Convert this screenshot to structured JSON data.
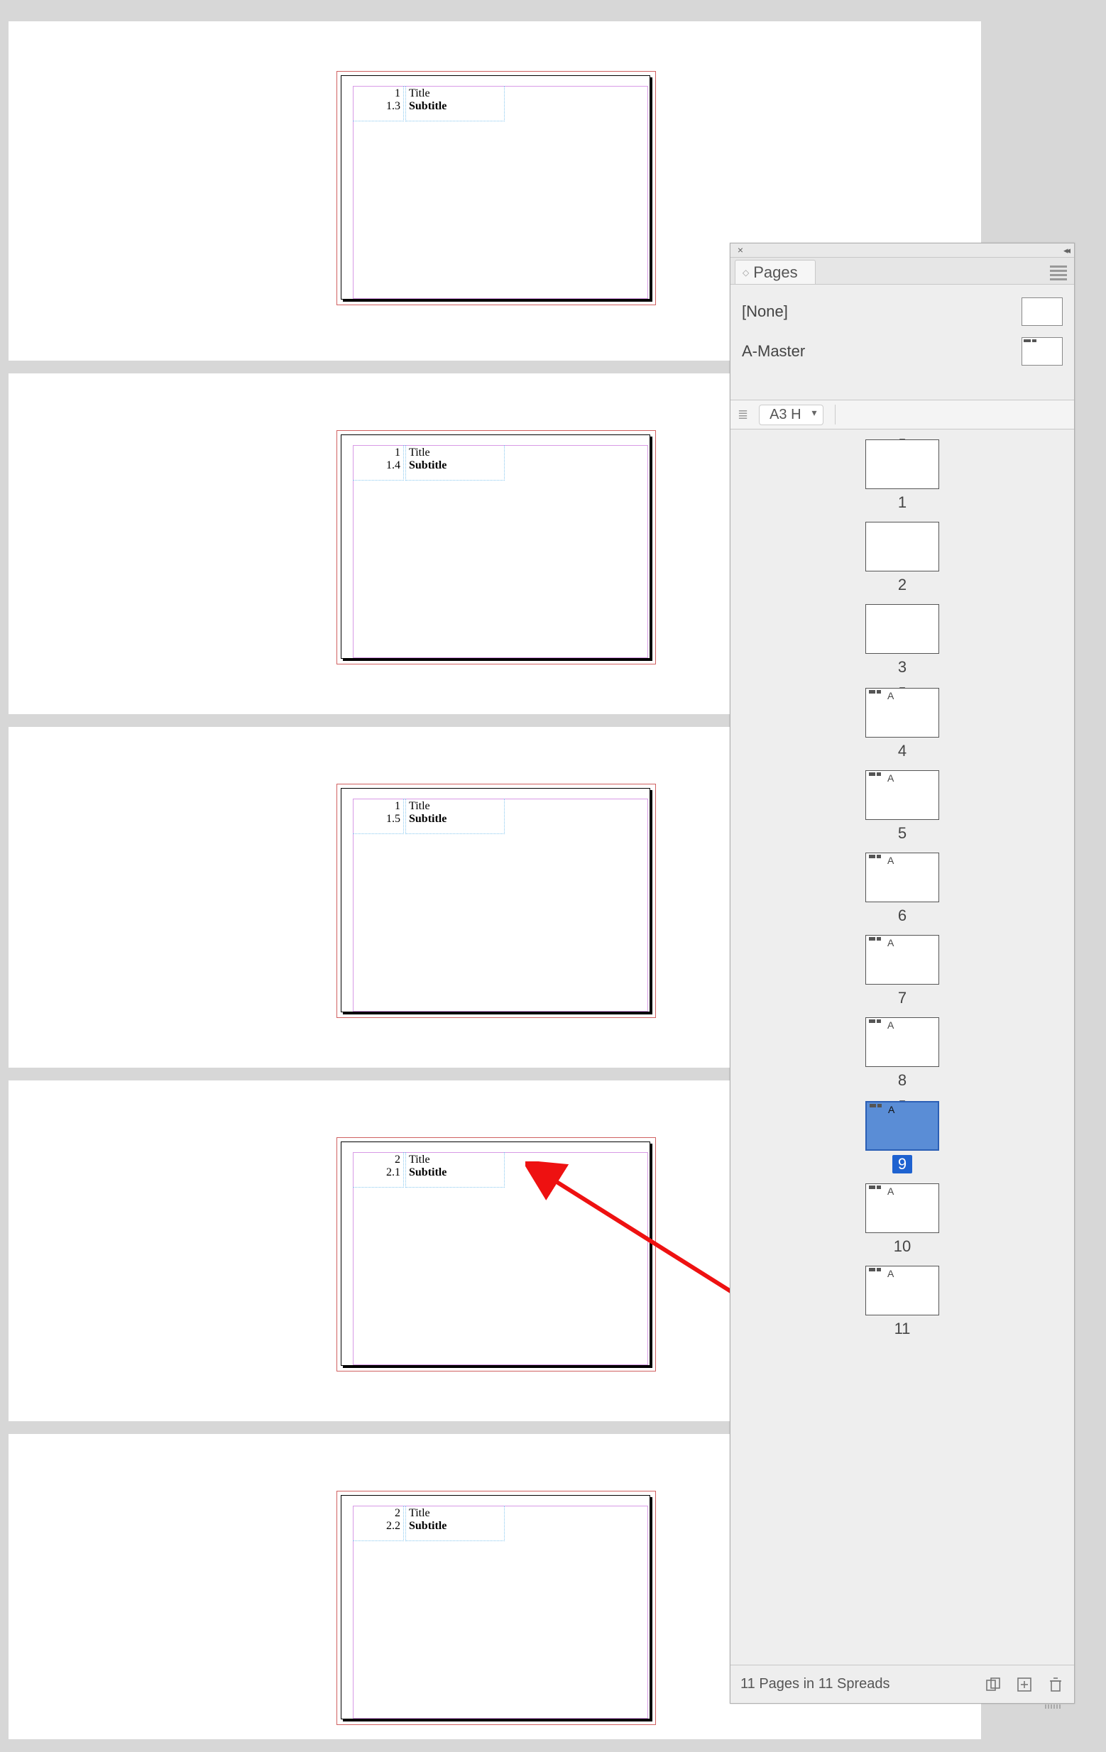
{
  "document_pages": [
    {
      "num1": "1",
      "num2": "1.3",
      "title": "Title",
      "subtitle": "Subtitle"
    },
    {
      "num1": "1",
      "num2": "1.4",
      "title": "Title",
      "subtitle": "Subtitle"
    },
    {
      "num1": "1",
      "num2": "1.5",
      "title": "Title",
      "subtitle": "Subtitle"
    },
    {
      "num1": "2",
      "num2": "2.1",
      "title": "Title",
      "subtitle": "Subtitle"
    },
    {
      "num1": "2",
      "num2": "2.2",
      "title": "Title",
      "subtitle": "Subtitle"
    }
  ],
  "panel": {
    "tab_label": "Pages",
    "masters": [
      {
        "label": "[None]",
        "type": "none"
      },
      {
        "label": "A-Master",
        "type": "a"
      }
    ],
    "page_size": "A3 H",
    "pages": [
      {
        "n": "1",
        "master": "",
        "section": true,
        "selected": false
      },
      {
        "n": "2",
        "master": "",
        "section": false,
        "selected": false
      },
      {
        "n": "3",
        "master": "",
        "section": false,
        "selected": false
      },
      {
        "n": "4",
        "master": "A",
        "section": true,
        "selected": false
      },
      {
        "n": "5",
        "master": "A",
        "section": false,
        "selected": false
      },
      {
        "n": "6",
        "master": "A",
        "section": false,
        "selected": false
      },
      {
        "n": "7",
        "master": "A",
        "section": false,
        "selected": false
      },
      {
        "n": "8",
        "master": "A",
        "section": false,
        "selected": false
      },
      {
        "n": "9",
        "master": "A",
        "section": true,
        "selected": true
      },
      {
        "n": "10",
        "master": "A",
        "section": false,
        "selected": false
      },
      {
        "n": "11",
        "master": "A",
        "section": false,
        "selected": false
      }
    ],
    "footer_status": "11 Pages in 11 Spreads"
  }
}
